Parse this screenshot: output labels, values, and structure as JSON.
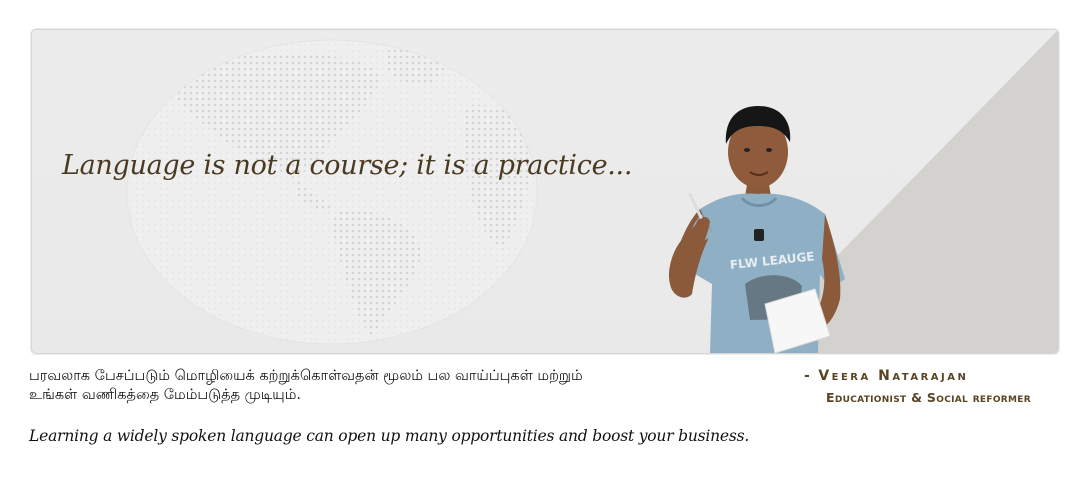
{
  "banner": {
    "tagline": "Language is not a course; it is a practice...",
    "globe_icon": "world-map-globe",
    "photo": "presenter-photo",
    "colors": {
      "background": "#ebebeb",
      "diagonal": "#d3d2ce",
      "tagline": "#4a3a21",
      "accent": "#5a4424"
    }
  },
  "body": {
    "tamil_line_1": "பரவலாக பேசப்படும் மொழியைக் கற்றுக்கொள்வதன் மூலம் பல வாய்ப்புகள் மற்றும்",
    "tamil_line_2": "உங்கள் வணிகத்தை மேம்படுத்த முடியும்.",
    "english": "Learning a widely spoken language can open up many opportunities and boost your business."
  },
  "author": {
    "dash": "-",
    "name": "Veera Natarajan",
    "title": "Educationist & Social reformer"
  }
}
